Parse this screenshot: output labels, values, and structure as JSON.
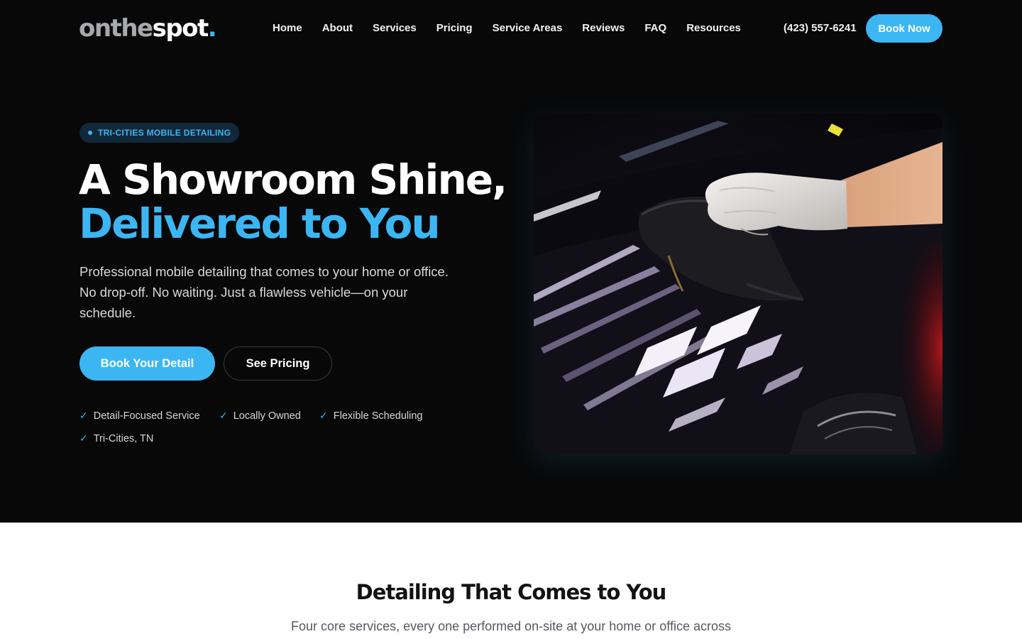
{
  "header": {
    "logo": {
      "part1": "onthe",
      "part2": "spot",
      "part3": "."
    },
    "nav": [
      "Home",
      "About",
      "Services",
      "Pricing",
      "Service Areas",
      "Reviews",
      "FAQ",
      "Resources"
    ],
    "phone": "(423) 557-6241",
    "book_now_label": "Book Now"
  },
  "hero": {
    "badge": "TRI-CITIES MOBILE DETAILING",
    "headline_line1": "A Showroom Shine,",
    "headline_line2": "Delivered to You",
    "lead": "Professional mobile detailing that comes to your home or office. No drop-off. No waiting. Just a flawless vehicle—on your schedule.",
    "primary_cta": "Book Your Detail",
    "secondary_cta": "See Pricing",
    "features": [
      "Detail-Focused Service",
      "Locally Owned",
      "Flexible Scheduling",
      "Tri-Cities, TN"
    ],
    "check_icon": "✓"
  },
  "services_section": {
    "title": "Detailing That Comes to You",
    "subtitle": "Four core services, every one performed on-site at your home or office across"
  },
  "colors": {
    "accent": "#3cb6f3",
    "hero_bg": "#080809",
    "badge_bg": "#11283a",
    "section_title": "#111214",
    "section_subtitle": "#55585e"
  },
  "icons": {
    "badge_dot": "dot-icon",
    "feature_check": "check-icon"
  }
}
